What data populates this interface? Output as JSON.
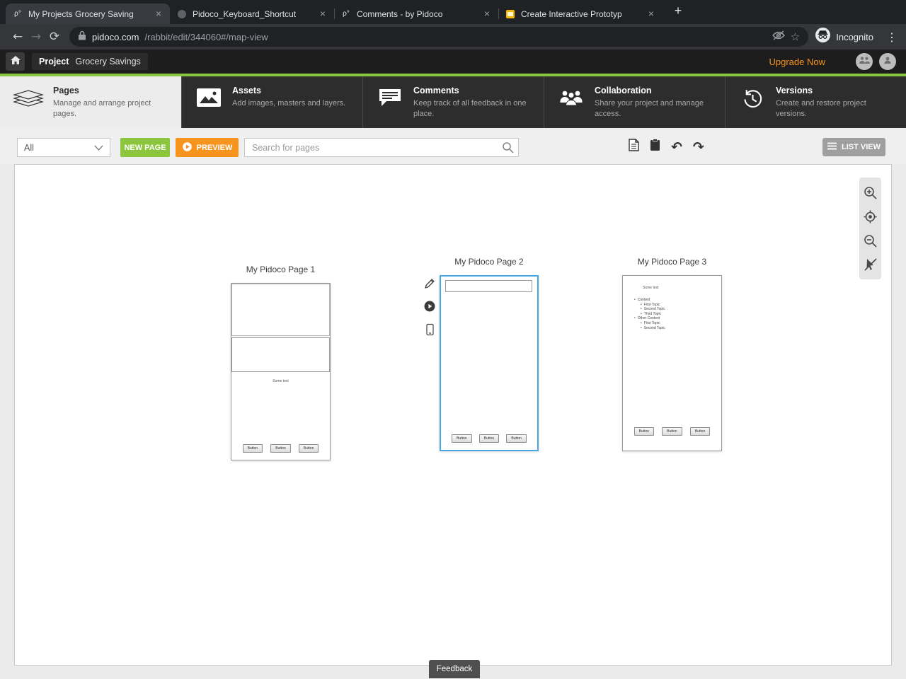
{
  "browser": {
    "tabs": [
      {
        "title": "My Projects Grocery Saving"
      },
      {
        "title": "Pidoco_Keyboard_Shortcut"
      },
      {
        "title": "Comments - by Pidoco"
      },
      {
        "title": "Create Interactive Prototyp"
      }
    ],
    "url_domain": "pidoco.com",
    "url_path": "/rabbit/edit/344060#/map-view",
    "incognito_label": "Incognito"
  },
  "icons": {
    "close": "×",
    "new_tab": "+",
    "menu_dots": "⋮",
    "back": "←",
    "forward": "→",
    "reload": "⟳",
    "star": "☆",
    "undo": "↶",
    "redo": "↷",
    "pidoco_logo": "ρ°"
  },
  "app_header": {
    "project_label": "Project",
    "project_name": "Grocery Savings",
    "upgrade_label": "Upgrade Now"
  },
  "nav": {
    "tiles": [
      {
        "title": "Pages",
        "description": "Manage and arrange project pages."
      },
      {
        "title": "Assets",
        "description": "Add images, masters and layers."
      },
      {
        "title": "Comments",
        "description": "Keep track of all feedback in one place."
      },
      {
        "title": "Collaboration",
        "description": "Share your project and manage access."
      },
      {
        "title": "Versions",
        "description": "Create and restore project versions."
      }
    ]
  },
  "toolbar": {
    "filter_value": "All",
    "new_page_label": "NEW PAGE",
    "preview_label": "PREVIEW",
    "search_placeholder": "Search for pages",
    "list_view_label": "LIST VIEW"
  },
  "canvas": {
    "pages": [
      {
        "name": "My Pidoco Page 1",
        "some_text": "Some text",
        "buttons": [
          "Button",
          "Button",
          "Button"
        ]
      },
      {
        "name": "My Pidoco Page 2",
        "buttons": [
          "Button",
          "Button",
          "Button"
        ]
      },
      {
        "name": "My Pidoco Page 3",
        "some_text": "Some text",
        "list": [
          "Content",
          "First Topic",
          "Second Topic",
          "Third Topic",
          "Other Content",
          "First Topic",
          "Second Topic"
        ],
        "buttons": [
          "Button",
          "Button",
          "Button"
        ]
      }
    ],
    "feedback_label": "Feedback"
  },
  "colors": {
    "brand_green": "#8cc63e",
    "accent_orange": "#f7941e",
    "selection_blue": "#45a8e0"
  }
}
